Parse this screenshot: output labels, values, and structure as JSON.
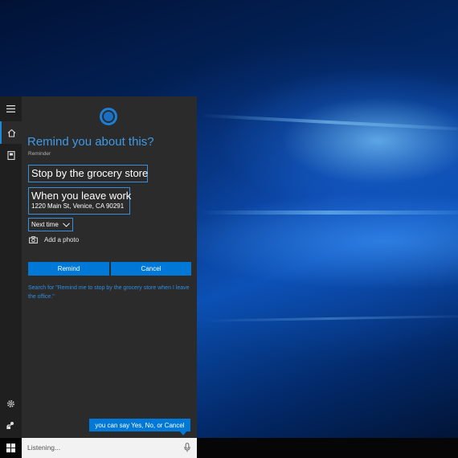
{
  "cortana": {
    "title": "Remind you about this?",
    "reminder_label": "Reminder",
    "subject": "Stop by the grocery store",
    "trigger": "When you leave work",
    "address": "1220 Main St, Venice, CA 90291",
    "time_option": "Next time",
    "add_photo_label": "Add a photo",
    "remind_button": "Remind",
    "cancel_button": "Cancel",
    "search_hint": "Search for \"Remind me to stop by the grocery store when I leave the office.\"",
    "voice_hint": "you can say Yes, No, or Cancel"
  },
  "taskbar": {
    "search_text": "Listening..."
  },
  "icons": {
    "hamburger": "hamburger-menu-icon",
    "home": "home-icon",
    "notebook": "notebook-icon",
    "settings": "gear-icon",
    "feedback": "feedback-icon",
    "camera": "camera-icon",
    "chevron": "chevron-down-icon",
    "start": "windows-logo-icon",
    "mic": "microphone-icon"
  },
  "colors": {
    "accent": "#0078d7",
    "title_blue": "#3d9be9",
    "panel_bg": "#2b2b2b",
    "rail_bg": "#1f1f1f"
  }
}
